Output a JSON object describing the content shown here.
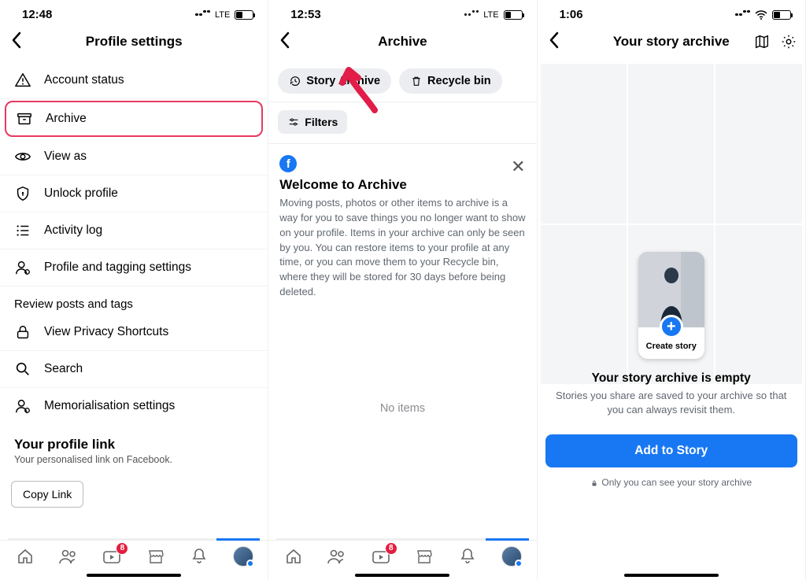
{
  "screen1": {
    "time": "12:48",
    "network": "LTE",
    "title": "Profile settings",
    "items": [
      {
        "label": "Account status"
      },
      {
        "label": "Archive"
      },
      {
        "label": "View as"
      },
      {
        "label": "Unlock profile"
      },
      {
        "label": "Activity log"
      },
      {
        "label": "Profile and tagging settings"
      }
    ],
    "review_label": "Review posts and tags",
    "items2": [
      {
        "label": "View Privacy Shortcuts"
      },
      {
        "label": "Search"
      },
      {
        "label": "Memorialisation settings"
      }
    ],
    "link_title": "Your profile link",
    "link_sub": "Your personalised link on Facebook.",
    "copy_label": "Copy Link",
    "badge": "8"
  },
  "screen2": {
    "time": "12:53",
    "network": "LTE",
    "title": "Archive",
    "chip_story": "Story Archive",
    "chip_recycle": "Recycle bin",
    "filters": "Filters",
    "welcome_title": "Welcome to Archive",
    "welcome_body": "Moving posts, photos or other items to archive is a way for you to save things you no longer want to show on your profile. Items in your archive can only be seen by you. You can restore items to your profile at any time, or you can move them to your Recycle bin, where they will be stored for 30 days before being deleted.",
    "no_items": "No items",
    "badge": "8"
  },
  "screen3": {
    "time": "1:06",
    "title": "Your story archive",
    "create_label": "Create story",
    "empty_title": "Your story archive is empty",
    "empty_body": "Stories you share are saved to your archive so that you can always revisit them.",
    "add_label": "Add to Story",
    "privacy": "Only you can see your story archive"
  }
}
